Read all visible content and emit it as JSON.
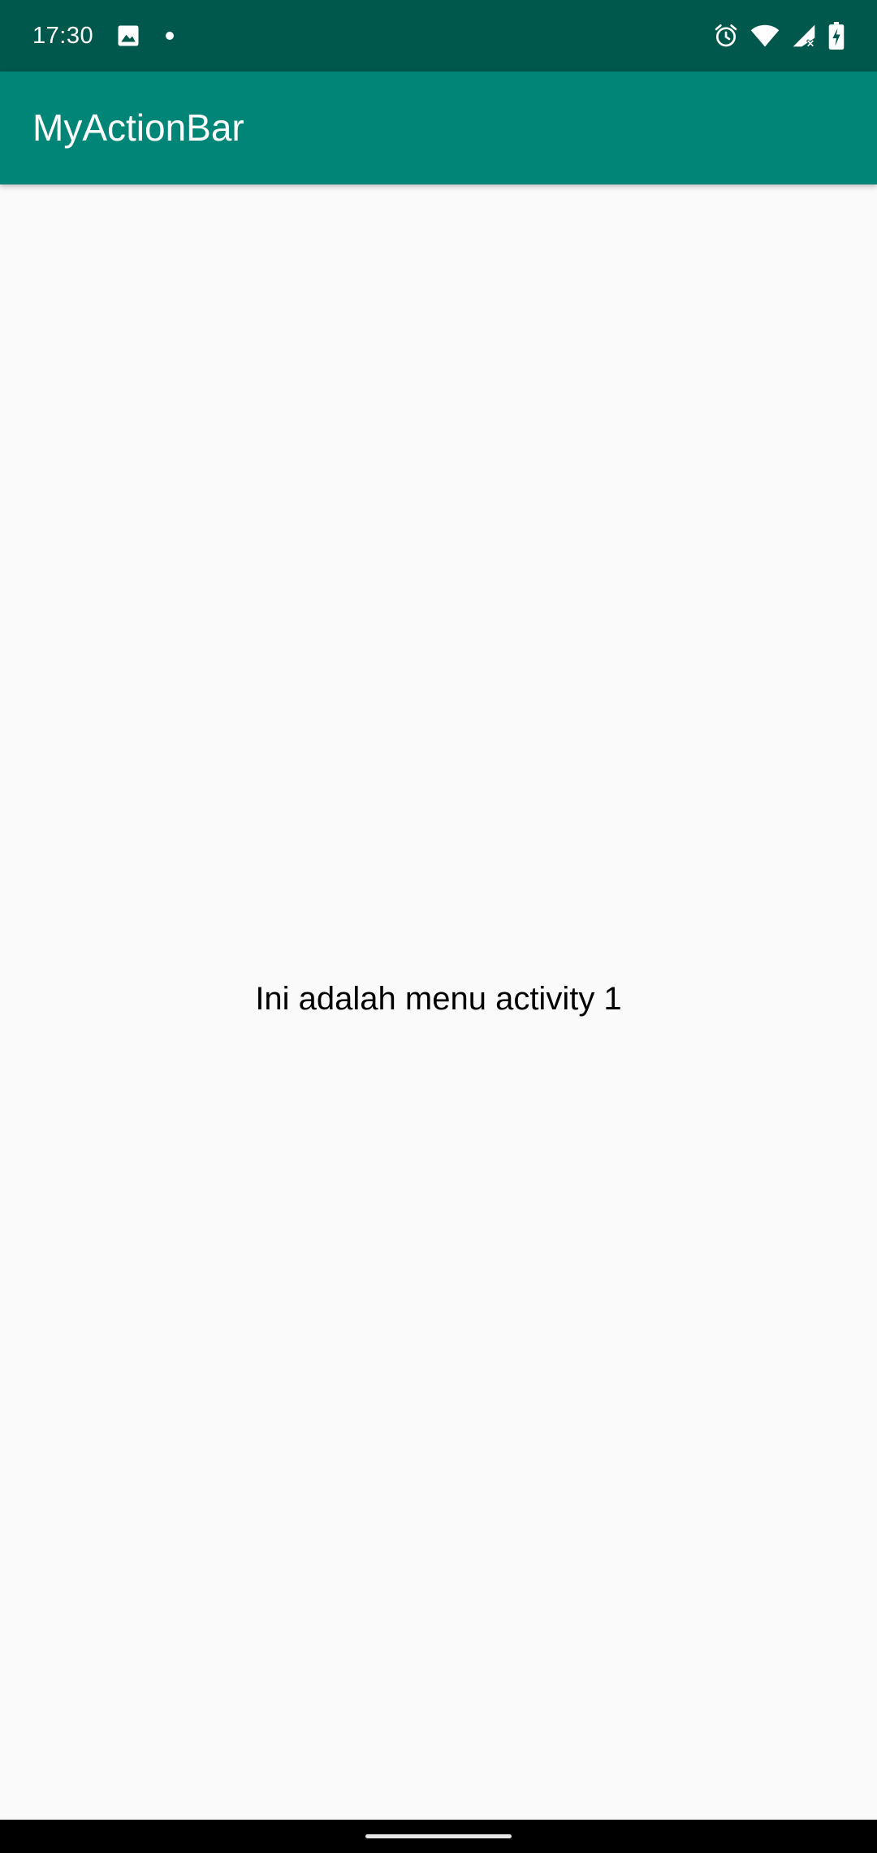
{
  "status_bar": {
    "time": "17:30",
    "icons_left": [
      "image-icon",
      "dot-icon"
    ],
    "icons_right": [
      "alarm-icon",
      "wifi-icon",
      "cellular-no-data-icon",
      "battery-charging-icon"
    ]
  },
  "app_bar": {
    "title": "MyActionBar"
  },
  "main": {
    "text": "Ini adalah menu activity 1"
  },
  "colors": {
    "status_bar": "#00574b",
    "app_bar": "#008577",
    "background": "#fafafa",
    "nav_bar": "#000000"
  }
}
